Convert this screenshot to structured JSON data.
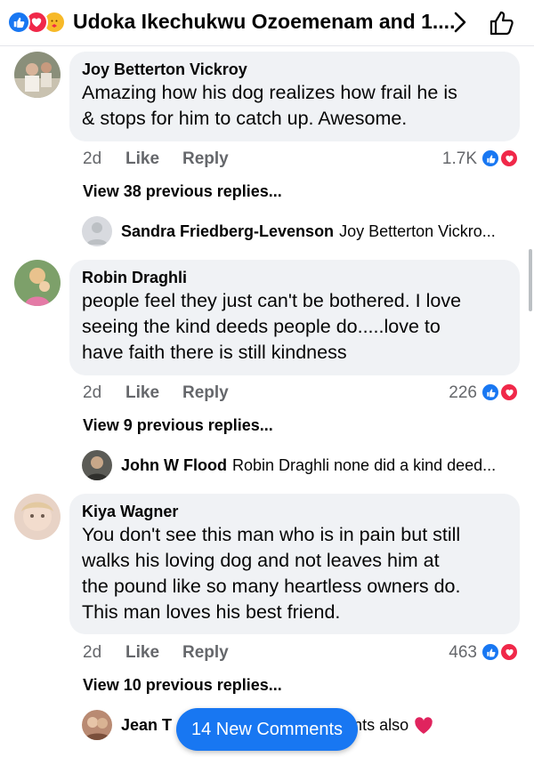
{
  "header": {
    "title": "Udoka Ikechukwu Ozoemenam and 1....",
    "reaction_icons": [
      "like-icon",
      "love-icon",
      "care-icon"
    ],
    "accent": "#1877f2"
  },
  "comments": [
    {
      "author": "Joy Betterton Vickroy",
      "text": "Amazing how his dog realizes how frail he is & stops for him to catch up. Awesome.",
      "lines": [
        "Amazing how his dog realizes how frail he is",
        "& stops for him to catch up. Awesome."
      ],
      "time": "2d",
      "like": "Like",
      "reply": "Reply",
      "reactions": "1.7K",
      "view_replies": "View 38 previous replies...",
      "latest_reply": {
        "author": "Sandra Friedberg-Levenson",
        "text": "Joy Betterton Vickro..."
      }
    },
    {
      "author": "Robin Draghli",
      "lines": [
        "people feel they just can't be bothered.  I love",
        "seeing the kind deeds people do.....love to",
        "have faith there is still kindness"
      ],
      "time": "2d",
      "like": "Like",
      "reply": "Reply",
      "reactions": "226",
      "view_replies": "View 9 previous replies...",
      "latest_reply": {
        "author": "John W Flood",
        "text": "Robin Draghli none did a kind deed..."
      }
    },
    {
      "author": "Kiya Wagner",
      "lines": [
        "You don't see this man who is in pain but still",
        "walks his loving dog and not leaves him at",
        "the pound like so many heartless owners do.",
        "This man loves his best friend."
      ],
      "time": "2d",
      "like": "Like",
      "reply": "Reply",
      "reactions": "463",
      "view_replies": "View 10 previous replies...",
      "latest_reply": {
        "author": "Jean T",
        "text": "entiments also"
      }
    }
  ],
  "toast": {
    "label": "14 New Comments"
  },
  "colors": {
    "like": "#1877f2",
    "love": "#f02849",
    "care": "#f7b928",
    "bubble": "#f0f2f5",
    "meta": "#65676b"
  }
}
